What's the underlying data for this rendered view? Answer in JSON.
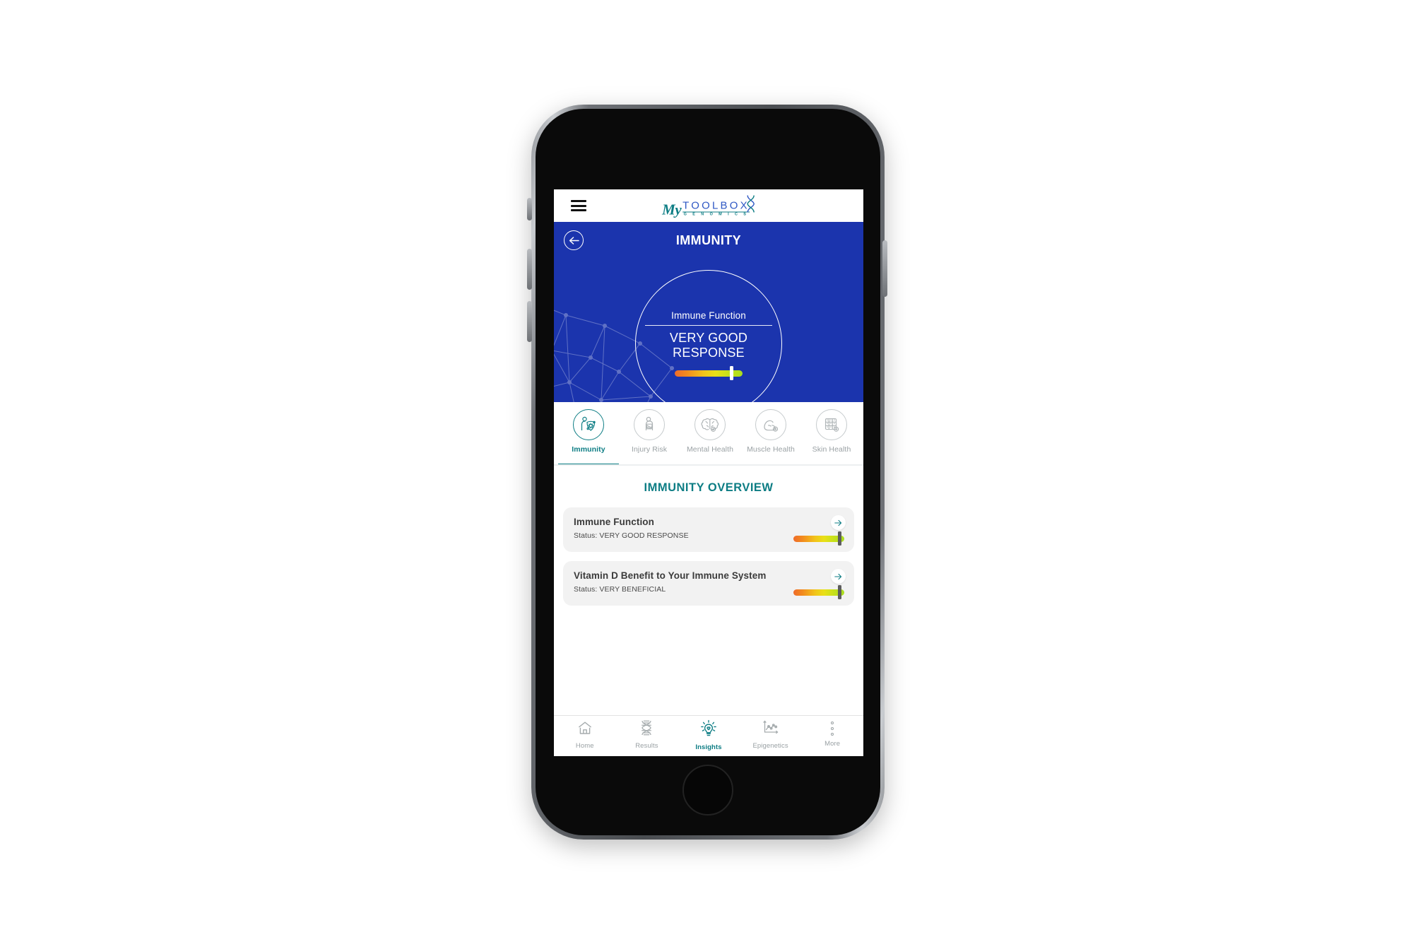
{
  "app": {
    "logo": {
      "my": "My",
      "toolbox": "TOOLBOX",
      "genomics": "G E N O M I C S",
      "helix_icon": "dna-helix-icon"
    },
    "menu_icon": "hamburger-menu-icon"
  },
  "hero": {
    "back_icon": "back-arrow-icon",
    "title": "IMMUNITY",
    "dial": {
      "label": "Immune Function",
      "status_line1": "VERY GOOD",
      "status_line2": "RESPONSE",
      "meter_position_pct": 81
    },
    "background_color": "#1b34ad",
    "network_icon": "network-constellation-pattern"
  },
  "tabs": {
    "active_index": 0,
    "items": [
      {
        "label": "Immunity",
        "icon": "immunity-shield-virus-icon"
      },
      {
        "label": "Injury Risk",
        "icon": "arm-sling-injury-icon"
      },
      {
        "label": "Mental Health",
        "icon": "brain-icon"
      },
      {
        "label": "Muscle Health",
        "icon": "flexed-bicep-icon"
      },
      {
        "label": "Skin Health",
        "icon": "skin-cells-icon"
      }
    ]
  },
  "overview": {
    "title": "IMMUNITY OVERVIEW",
    "cards": [
      {
        "title": "Immune Function",
        "status": "Status: VERY GOOD RESPONSE",
        "arrow_icon": "arrow-right-icon",
        "meter_position_pct": 88
      },
      {
        "title": "Vitamin D Benefit to Your Immune System",
        "status": "Status: VERY BENEFICIAL",
        "arrow_icon": "arrow-right-icon",
        "meter_position_pct": 88
      }
    ]
  },
  "bottom_nav": {
    "active_index": 2,
    "items": [
      {
        "label": "Home",
        "icon": "home-icon"
      },
      {
        "label": "Results",
        "icon": "dna-helix-icon"
      },
      {
        "label": "Insights",
        "icon": "lightbulb-idea-icon"
      },
      {
        "label": "Epigenetics",
        "icon": "line-chart-icon"
      },
      {
        "label": "More",
        "icon": "more-vertical-dots-icon"
      }
    ]
  },
  "colors": {
    "brand_blue": "#1b34ad",
    "brand_teal": "#0d7d84",
    "logo_blue": "#2f58c4",
    "card_bg": "#f2f2f2",
    "meter_gradient_start": "#ef6b2a",
    "meter_gradient_end": "#a8dd1f"
  }
}
